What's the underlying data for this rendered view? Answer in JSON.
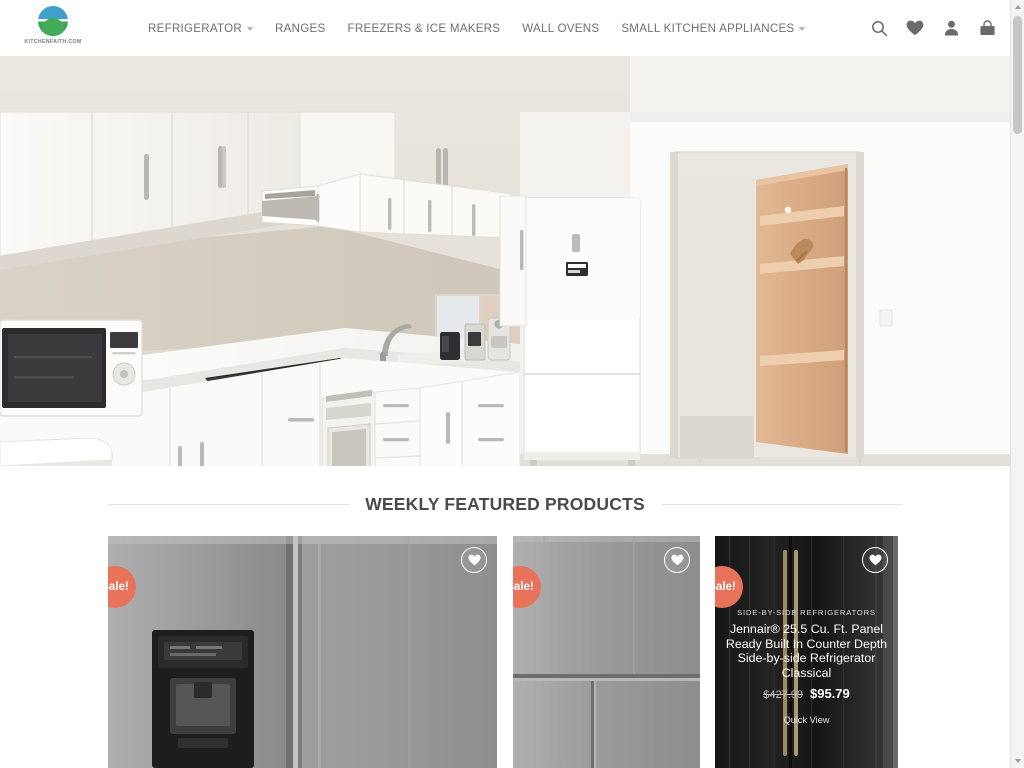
{
  "site": {
    "logo_text": "KITCHENFAITH.COM",
    "logo_icon": "circle-logo-icon"
  },
  "nav": {
    "items": [
      {
        "label": "REFRIGERATOR",
        "has_dropdown": true
      },
      {
        "label": "RANGES",
        "has_dropdown": false
      },
      {
        "label": "FREEZERS & ICE MAKERS",
        "has_dropdown": false
      },
      {
        "label": "WALL OVENS",
        "has_dropdown": false
      },
      {
        "label": "SMALL KITCHEN APPLIANCES",
        "has_dropdown": true
      }
    ]
  },
  "header_icons": [
    {
      "name": "search-icon"
    },
    {
      "name": "wishlist-heart-icon"
    },
    {
      "name": "account-user-icon"
    },
    {
      "name": "cart-bag-icon"
    }
  ],
  "hero": {
    "alt": "Modern white kitchen with cabinets, microwave, cooktop, oven and white refrigerator beside an open doorway with wooden corner shelving"
  },
  "featured": {
    "title": "WEEKLY FEATURED PRODUCTS",
    "cards": [
      {
        "badge": "Sale!",
        "wishlist_icon": "heart-icon",
        "image_alt": "Stainless steel side-by-side refrigerator with external water and ice dispenser",
        "overlay_visible": false
      },
      {
        "badge": "Sale!",
        "wishlist_icon": "heart-icon",
        "image_alt": "Stainless steel built-in counter depth refrigerator",
        "overlay_visible": false
      },
      {
        "badge": "Sale!",
        "wishlist_icon": "heart-icon",
        "image_alt": "Black panel ready built in counter depth side-by-side refrigerator",
        "overlay_visible": true,
        "category": "SIDE-BY-SIDE REFRIGERATORS",
        "title": "Jennair® 25.5 Cu. Ft. Panel Ready Built In Counter Depth Side-by-side Refrigerator Classical",
        "price_old": "$427.99",
        "price_new": "$95.79",
        "quick_view": "Quick View"
      }
    ]
  },
  "colors": {
    "sale_badge": "#e8725a",
    "nav_text": "#6f6f6f",
    "title_text": "#4a4a4a",
    "logo_blue": "#3fa0c9",
    "logo_green": "#3aa757"
  },
  "scrollbar": {
    "up_icon": "chevron-up-icon",
    "down_icon": "chevron-down-icon"
  }
}
